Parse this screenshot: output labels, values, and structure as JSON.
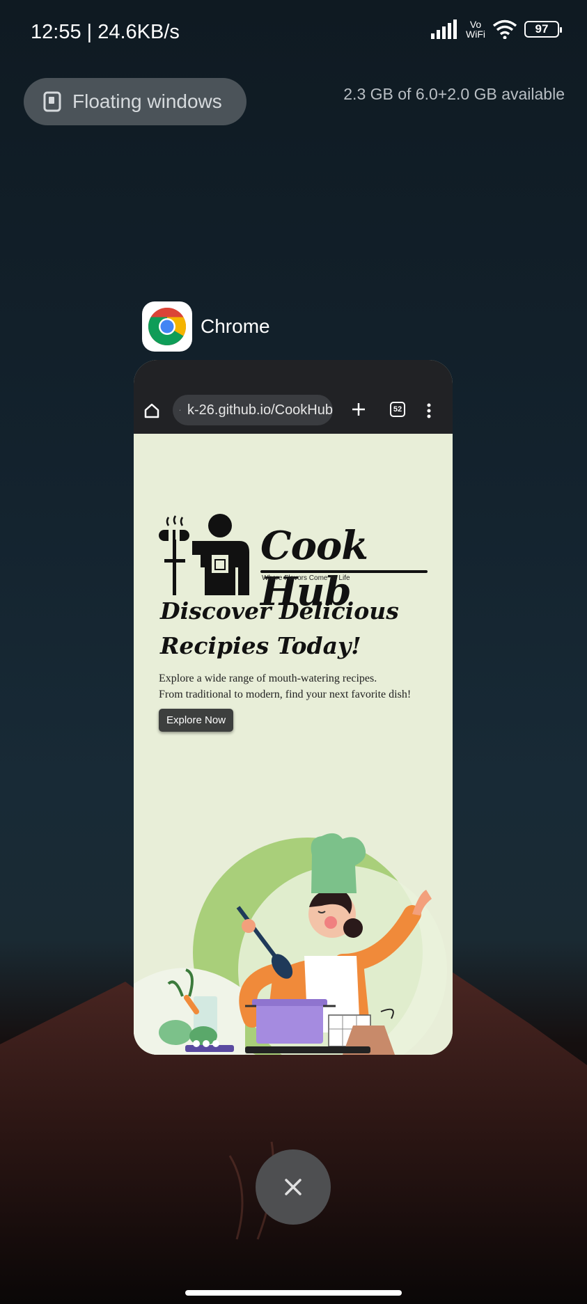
{
  "status_bar": {
    "time_speed": "12:55 | 24.6KB/s",
    "vowifi_top": "Vo",
    "vowifi_bottom": "WiFi",
    "battery": "97"
  },
  "recents": {
    "floating_windows_label": "Floating windows",
    "memory_text": "2.3 GB of 6.0+2.0 GB available"
  },
  "app_card": {
    "app_name": "Chrome",
    "url": "k-26.github.io/CookHub",
    "tab_count": "52",
    "page": {
      "brand": "Cook Hub",
      "tagline": "Where Flavors Come To Life",
      "headline_line1": "Discover Delicious",
      "headline_line2": "Recipies Today!",
      "desc_line1": "Explore a wide range of mouth-watering recipes.",
      "desc_line2": "From traditional to modern, find your next favorite dish!",
      "button": "Explore Now"
    }
  }
}
